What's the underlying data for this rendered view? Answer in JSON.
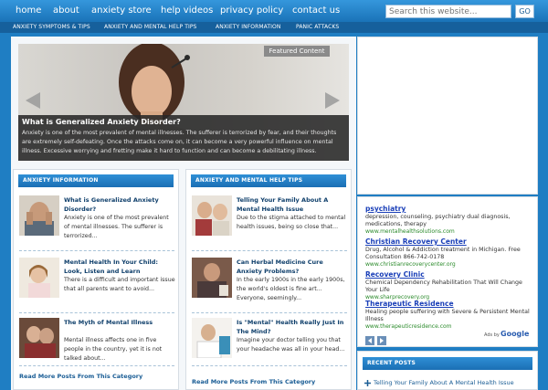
{
  "nav": {
    "items": [
      "home",
      "about",
      "anxiety store",
      "help videos",
      "privacy policy",
      "contact us"
    ],
    "search_placeholder": "Search this website...",
    "search_button": "GO"
  },
  "subnav": {
    "items": [
      "ANXIETY SYMPTOMS & TIPS",
      "ANXIETY AND MENTAL HELP TIPS",
      "ANXIETY INFORMATION",
      "PANIC ATTACKS"
    ]
  },
  "slider": {
    "badge": "Featured Content",
    "title": "What is Generalized Anxiety Disorder?",
    "text": "Anxiety is one of the most prevalent of mental illnesses. The sufferer is terrorized by fear, and their thoughts are extremely self-defeating. Once the attacks come on, it can become a very powerful influence on mental illness. Excessive worrying and fretting make it hard to function and can become a debilitating illness."
  },
  "columns": [
    {
      "header": "ANXIETY INFORMATION",
      "posts": [
        {
          "title": "What is Generalized Anxiety Disorder?",
          "excerpt": "Anxiety is one of the most prevalent of mental illnesses. The sufferer is terrorized..."
        },
        {
          "title": "Mental Health In Your Child: Look, Listen and Learn",
          "excerpt": "There is a difficult and important issue that all parents want to avoid..."
        },
        {
          "title": "The Myth of Mental Illness",
          "excerpt": "Mental illness affects one in five people in the country, yet it is not talked about..."
        }
      ],
      "read_more": "Read More Posts From This Category"
    },
    {
      "header": "ANXIETY AND MENTAL HELP TIPS",
      "posts": [
        {
          "title": "Telling Your Family About A Mental Health Issue",
          "excerpt": "Due to the stigma attached to mental health issues, being so close that..."
        },
        {
          "title": "Can Herbal Medicine Cure Anxiety Problems?",
          "excerpt": "In the early 1900s in the early 1900s, the world's oldest is fine art... Everyone, seemingly..."
        },
        {
          "title": "Is \"Mental\" Health Really Just In The Mind?",
          "excerpt": "Imagine your doctor telling you that your headache was all in your head..."
        }
      ],
      "read_more": "Read More Posts From This Category"
    }
  ],
  "ads": {
    "items": [
      {
        "title": "psychiatry",
        "desc": "depression, counseling, psychiatry dual diagnosis, medications, therapy",
        "url": "www.mentalhealthsolutions.com"
      },
      {
        "title": "Christian Recovery Center",
        "desc": "Drug, Alcohol & Addiction treatment in Michigan. Free Consultation 866-742-0178",
        "url": "www.christianrecoverycenter.org"
      },
      {
        "title": "Recovery Clinic",
        "desc": "Chemical Dependency Rehabilitation That Will Change Your Life",
        "url": "www.sharprecovery.org"
      },
      {
        "title": "Therapeutic Residence",
        "desc": "Healing people suffering with Severe & Persistent Mental Illness",
        "url": "www.therapeuticresidence.com"
      }
    ],
    "ads_by": "Ads by",
    "google": "Google"
  },
  "recent": {
    "header": "RECENT POSTS",
    "item": "Telling Your Family About A Mental Health Issue"
  }
}
